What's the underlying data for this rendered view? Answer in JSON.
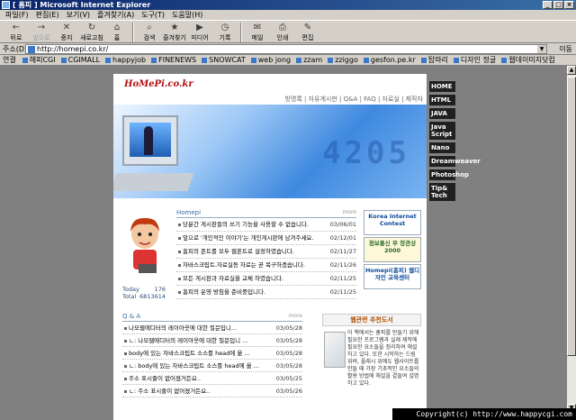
{
  "window": {
    "title": "Microsoft Internet Explorer",
    "title_prefix": "[ 홈피 ]"
  },
  "menu": [
    "파일(F)",
    "편집(E)",
    "보기(V)",
    "즐겨찾기(A)",
    "도구(T)",
    "도움말(H)"
  ],
  "toolbar": [
    {
      "label": "뒤로",
      "icon": "back-icon"
    },
    {
      "label": "앞으로",
      "icon": "forward-icon",
      "disabled": true
    },
    {
      "label": "중지",
      "icon": "stop-icon"
    },
    {
      "label": "새로고침",
      "icon": "refresh-icon"
    },
    {
      "label": "홈",
      "icon": "home-icon"
    },
    {
      "label": "검색",
      "icon": "search-icon"
    },
    {
      "label": "즐겨찾기",
      "icon": "favorites-icon"
    },
    {
      "label": "미디어",
      "icon": "media-icon"
    },
    {
      "label": "기록",
      "icon": "history-icon"
    },
    {
      "label": "메일",
      "icon": "mail-icon"
    },
    {
      "label": "인쇄",
      "icon": "print-icon"
    },
    {
      "label": "편집",
      "icon": "edit-icon"
    }
  ],
  "address": {
    "label": "주소(D)",
    "value": "http://homepi.co.kr/",
    "go": "이동"
  },
  "links": {
    "title": "연결",
    "items": [
      "해피CGI",
      "CGIMALL",
      "happyjob",
      "FINENEWS",
      "SNOWCAT",
      "web jong",
      "zzam",
      "zziggo",
      "gesfon.pe.kr",
      "탑마리",
      "디자인 정글",
      "웹데이미지닷컴"
    ]
  },
  "site": {
    "logo": "HoMePi.co.kr",
    "topnav": "방명록 | 자유게시판 | Q&A | FAQ | 자료실 | 제작자",
    "banner_number": "4205",
    "sidenav": [
      "HOME",
      "HTML",
      "JAVA",
      "Java Script",
      "Nano",
      "Dreamweaver",
      "Photoshop",
      "Tip& Tech"
    ],
    "notice_title": "Homepi",
    "notice_more": "more",
    "notices": [
      {
        "text": "당분간 게시판들의 쓰기 기능을 사용할 수 없습니다.",
        "date": "03/06/01"
      },
      {
        "text": "앞으로 '개인적인 이야기'는 개인게시판에 남겨주세요.",
        "date": "02/12/01"
      },
      {
        "text": "홈피의 폰트를 모두 웹폰트로 설정하였습니다.",
        "date": "02/11/27"
      },
      {
        "text": "자바스크립트.자료실등 자료는 곧 복구하겠습니다.",
        "date": "02/11/26"
      },
      {
        "text": "모든 게시판과 자료실을 교체 하였습니다.",
        "date": "02/11/25"
      },
      {
        "text": "홈피의 운영 방침을 준비중입니다.",
        "date": "02/11/25"
      }
    ],
    "counter": {
      "today_label": "Today",
      "today": "176",
      "total_label": "Total",
      "total": "6813614"
    },
    "banners": [
      "Korea Internet Contest",
      "정보통신 부 장관상 2000",
      "Homepi(홈피) 웹디자인 교육센터"
    ],
    "qna_title": "Q & A",
    "qna_more": "more",
    "qna": [
      {
        "text": "나모웹에디터의 레이아웃에 대한 질문입니...",
        "date": "03/05/28"
      },
      {
        "text": "ㄴ: 나모웹에디터의 레이아웃에 대한 질문입니 ...",
        "date": "03/05/28"
      },
      {
        "text": "body에 있는 자바스크립트 소스를 head에 옮 ...",
        "date": "03/05/28"
      },
      {
        "text": "ㄴ: body에 있는 자바스크립트 소스를 head에 옮 ...",
        "date": "03/05/28"
      },
      {
        "text": "주소 표시줄이 없어졌거든요..",
        "date": "03/05/25"
      },
      {
        "text": "ㄴ: 주소 표시줄이 없어졌거든요..",
        "date": "03/05/26"
      }
    ],
    "web_title": "웹관련 추천도서",
    "web_text": "이 책에서는 홈피를 만들기 위해 필요한 프로그램과 실제 제작에 필요한 요소들을 정리하여 해설하고 있다. 또한 시작하는 드림위버, 플래시 위에도 웹사이트를 만들 때 가장 기초적인 요소들의 활용 방법에 해설을 곁들여 설명하고 있다."
  },
  "copyright": "Copyright(c) http://www.happycgi.com"
}
